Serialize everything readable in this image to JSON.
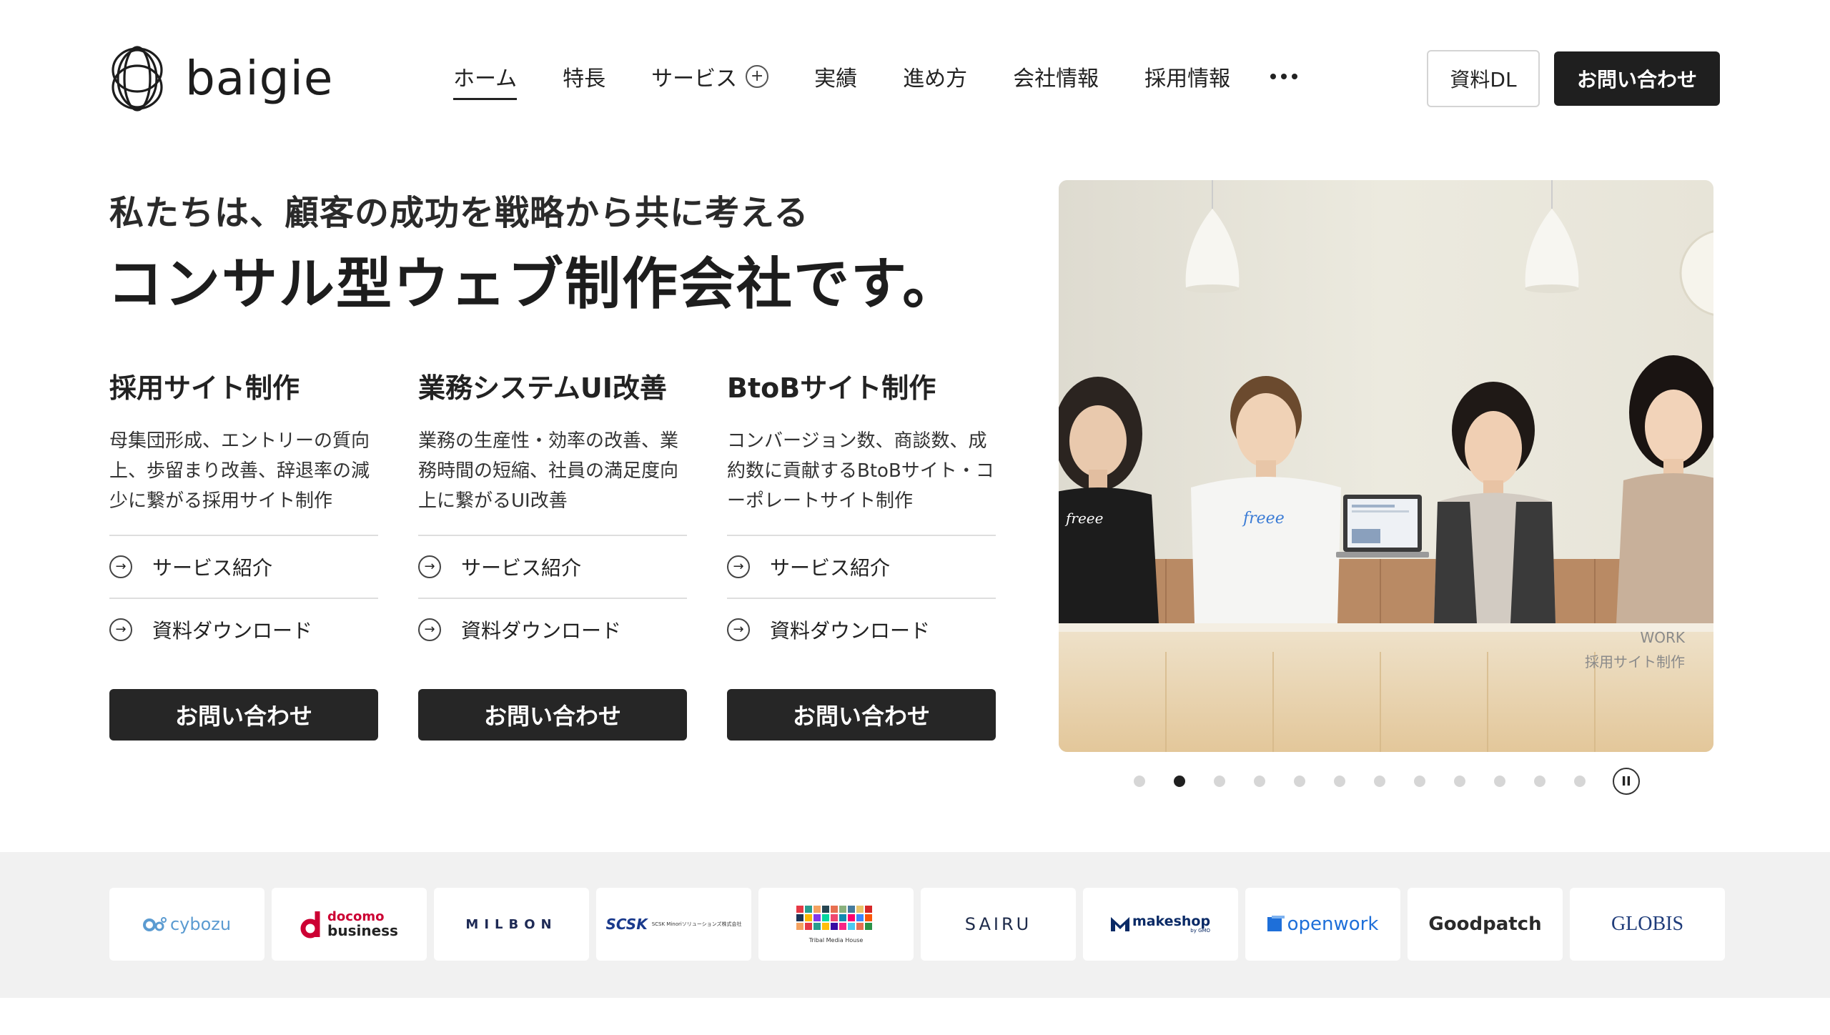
{
  "brand": {
    "name": "baigie"
  },
  "nav": {
    "items": [
      {
        "label": "ホーム",
        "active": true
      },
      {
        "label": "特長"
      },
      {
        "label": "サービス",
        "expandable": true
      },
      {
        "label": "実績"
      },
      {
        "label": "進め方"
      },
      {
        "label": "会社情報"
      },
      {
        "label": "採用情報"
      }
    ],
    "plus_symbol": "+",
    "doc_button": "資料DL",
    "contact_button": "お問い合わせ"
  },
  "hero": {
    "tagline": "私たちは、顧客の成功を戦略から共に考える",
    "headline": "コンサル型ウェブ制作会社です。"
  },
  "services": [
    {
      "title": "採用サイト制作",
      "description": "母集団形成、エントリーの質向上、歩留まり改善、辞退率の減少に繋がる採用サイト制作",
      "link1": "サービス紹介",
      "link2": "資料ダウンロード",
      "cta": "お問い合わせ"
    },
    {
      "title": "業務システムUI改善",
      "description": "業務の生産性・効率の改善、業務時間の短縮、社員の満足度向上に繋がるUI改善",
      "link1": "サービス紹介",
      "link2": "資料ダウンロード",
      "cta": "お問い合わせ"
    },
    {
      "title": "BtoBサイト制作",
      "description": "コンバージョン数、商談数、成約数に貢献するBtoBサイト・コーポレートサイト制作",
      "link1": "サービス紹介",
      "link2": "資料ダウンロード",
      "cta": "お問い合わせ"
    }
  ],
  "slider": {
    "caption_label": "WORK",
    "caption_text": "採用サイト制作",
    "shirt_text": "freee",
    "total_slides": 12,
    "active_index": 1,
    "pause_symbol": "II"
  },
  "clients": [
    {
      "name": "cybozu"
    },
    {
      "name_top": "docomo",
      "name_bottom": "business"
    },
    {
      "name": "MILBON"
    },
    {
      "name": "SCSK",
      "sub": "SCSK Minoriソリューションズ株式会社"
    },
    {
      "name": "Tribal Media House"
    },
    {
      "name": "SAIRU"
    },
    {
      "name": "makeshop",
      "sub": "by GMO"
    },
    {
      "name": "openwork"
    },
    {
      "name": "Goodpatch"
    },
    {
      "name": "GLOBIS"
    }
  ],
  "colors": {
    "primary_dark": "#1f1f1f",
    "text": "#222222",
    "band_bg": "#f1f1f1",
    "cybozu_blue": "#5b9bd1",
    "docomo_red": "#cc0033",
    "scsk_blue": "#1a3a8c",
    "makeshop_navy": "#0a2a66",
    "openwork_blue": "#1e6fd9",
    "globis_navy": "#1f3c7a"
  }
}
